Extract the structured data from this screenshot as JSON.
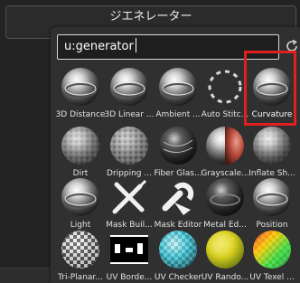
{
  "generator_button": {
    "label": "ジエネレーター",
    "sub": "・・・・・・・・・"
  },
  "search": {
    "value": "u:generator"
  },
  "colors": {
    "highlight": "#e02020",
    "popup_bg": "#303030"
  },
  "tiles": [
    {
      "label": "3D Distance",
      "icon": "chrome-sphere-icon"
    },
    {
      "label": "3D Linear ...",
      "icon": "chrome-sphere-icon"
    },
    {
      "label": "Ambient ...",
      "icon": "chrome-sphere-icon"
    },
    {
      "label": "Auto Stitc...",
      "icon": "dashed-circle-icon"
    },
    {
      "label": "Curvature",
      "icon": "chrome-sphere-icon",
      "selected": true
    },
    {
      "label": "Dirt",
      "icon": "dirt-sphere-icon"
    },
    {
      "label": "Dripping ...",
      "icon": "dripping-sphere-icon"
    },
    {
      "label": "Fiber Glas...",
      "icon": "fiber-sphere-icon"
    },
    {
      "label": "Grayscale...",
      "icon": "red-gray-sphere-icon"
    },
    {
      "label": "Inflate Sh...",
      "icon": "inflate-sphere-icon"
    },
    {
      "label": "Light",
      "icon": "chrome-sphere-icon"
    },
    {
      "label": "Mask Buil...",
      "icon": "brush-pencil-icon"
    },
    {
      "label": "Mask Editor",
      "icon": "wrench-icon"
    },
    {
      "label": "Metal Ed...",
      "icon": "dark-chrome-sphere-icon"
    },
    {
      "label": "Position",
      "icon": "chrome-sphere-icon"
    },
    {
      "label": "Tri-Planar...",
      "icon": "checker-sphere-icon"
    },
    {
      "label": "UV Borde...",
      "icon": "uv-border-icon"
    },
    {
      "label": "UV Checker",
      "icon": "uv-checker-sphere-icon"
    },
    {
      "label": "UV Rando...",
      "icon": "uv-random-sphere-icon"
    },
    {
      "label": "UV Texel ...",
      "icon": "uv-texel-sphere-icon"
    }
  ]
}
